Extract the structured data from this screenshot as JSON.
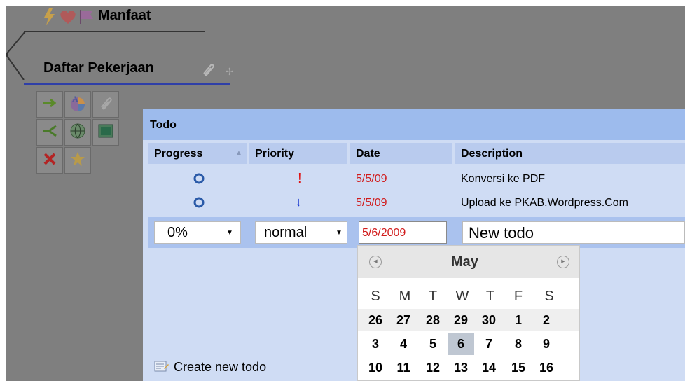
{
  "mindmap": {
    "node_manfaat": "Manfaat",
    "node_daftar": "Daftar Pekerjaan"
  },
  "toolbox": {
    "icons": [
      "arrow-right-icon",
      "color-wheel-icon",
      "paperclip-icon",
      "branch-icon",
      "globe-icon",
      "image-icon",
      "delete-x-icon",
      "star-icon"
    ]
  },
  "todo": {
    "title": "Todo",
    "columns": {
      "progress": "Progress",
      "priority": "Priority",
      "date": "Date",
      "description": "Description"
    },
    "rows": [
      {
        "progress_icon": "circle-icon",
        "priority": "!",
        "date": "5/5/09",
        "description": "Konversi ke PDF"
      },
      {
        "progress_icon": "circle-icon",
        "priority": "↓",
        "date": "5/5/09",
        "description": "Upload ke PKAB.Wordpress.Com"
      }
    ],
    "edit_row": {
      "progress_value": "0%",
      "priority_value": "normal",
      "date_value": "5/6/2009",
      "description_value": "New todo"
    },
    "create_link": "Create new todo"
  },
  "calendar": {
    "month": "May",
    "prev_label": "◀",
    "next_label": "▶",
    "weekdays": [
      "S",
      "M",
      "T",
      "W",
      "T",
      "F",
      "S"
    ],
    "weeks": [
      [
        "26",
        "27",
        "28",
        "29",
        "30",
        "1",
        "2"
      ],
      [
        "3",
        "4",
        "5",
        "6",
        "7",
        "8",
        "9"
      ],
      [
        "10",
        "11",
        "12",
        "13",
        "14",
        "15",
        "16"
      ]
    ],
    "today_day": "6",
    "selected_day": "5"
  }
}
